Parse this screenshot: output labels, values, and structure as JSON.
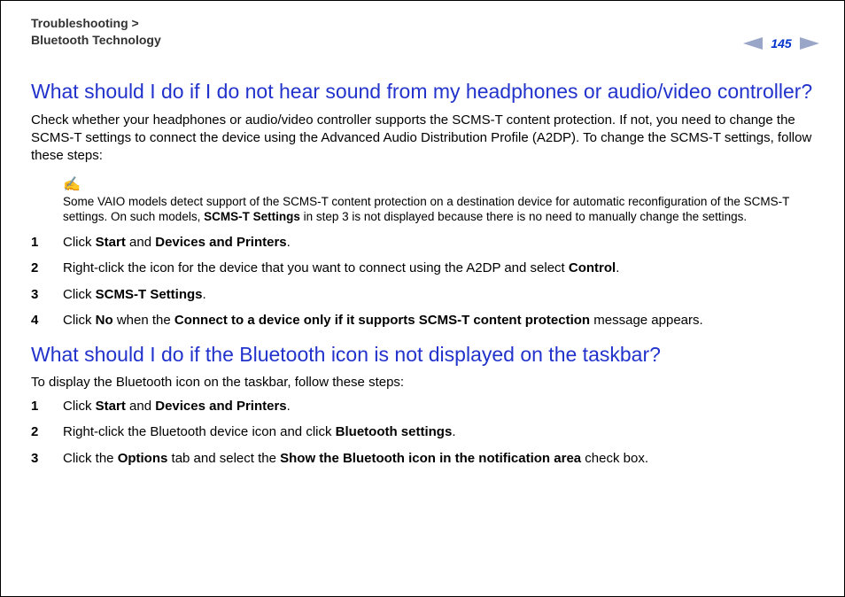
{
  "header": {
    "breadcrumb_section": "Troubleshooting",
    "breadcrumb_sep": ">",
    "breadcrumb_topic": "Bluetooth Technology",
    "page_number": "145"
  },
  "section1": {
    "title": "What should I do if I do not hear sound from my headphones or audio/video controller?",
    "intro": "Check whether your headphones or audio/video controller supports the SCMS-T content protection. If not, you need to change the SCMS-T settings to connect the device using the Advanced Audio Distribution Profile (A2DP). To change the SCMS-T settings, follow these steps:",
    "note_icon": "✍",
    "note_pre": "Some VAIO models detect support of the SCMS-T content protection on a destination device for automatic reconfiguration of the SCMS-T settings. On such models, ",
    "note_bold": "SCMS-T Settings",
    "note_post": " in step 3 is not displayed because there is no need to manually change the settings.",
    "steps": {
      "s1": {
        "num": "1",
        "a": "Click ",
        "b1": "Start",
        "mid": " and ",
        "b2": "Devices and Printers",
        "end": "."
      },
      "s2": {
        "num": "2",
        "a": "Right-click the icon for the device that you want to connect using the A2DP and select ",
        "b1": "Control",
        "end": "."
      },
      "s3": {
        "num": "3",
        "a": "Click ",
        "b1": "SCMS-T Settings",
        "end": "."
      },
      "s4": {
        "num": "4",
        "a": "Click ",
        "b1": "No",
        "mid": " when the ",
        "b2": "Connect to a device only if it supports SCMS-T content protection",
        "end": " message appears."
      }
    }
  },
  "section2": {
    "title": "What should I do if the Bluetooth icon is not displayed on the taskbar?",
    "intro": "To display the Bluetooth icon on the taskbar, follow these steps:",
    "steps": {
      "s1": {
        "num": "1",
        "a": "Click ",
        "b1": "Start",
        "mid": " and ",
        "b2": "Devices and Printers",
        "end": "."
      },
      "s2": {
        "num": "2",
        "a": "Right-click the Bluetooth device icon and click ",
        "b1": "Bluetooth settings",
        "end": "."
      },
      "s3": {
        "num": "3",
        "a": "Click the ",
        "b1": "Options",
        "mid": " tab and select the ",
        "b2": "Show the Bluetooth icon in the notification area",
        "end": " check box."
      }
    }
  }
}
